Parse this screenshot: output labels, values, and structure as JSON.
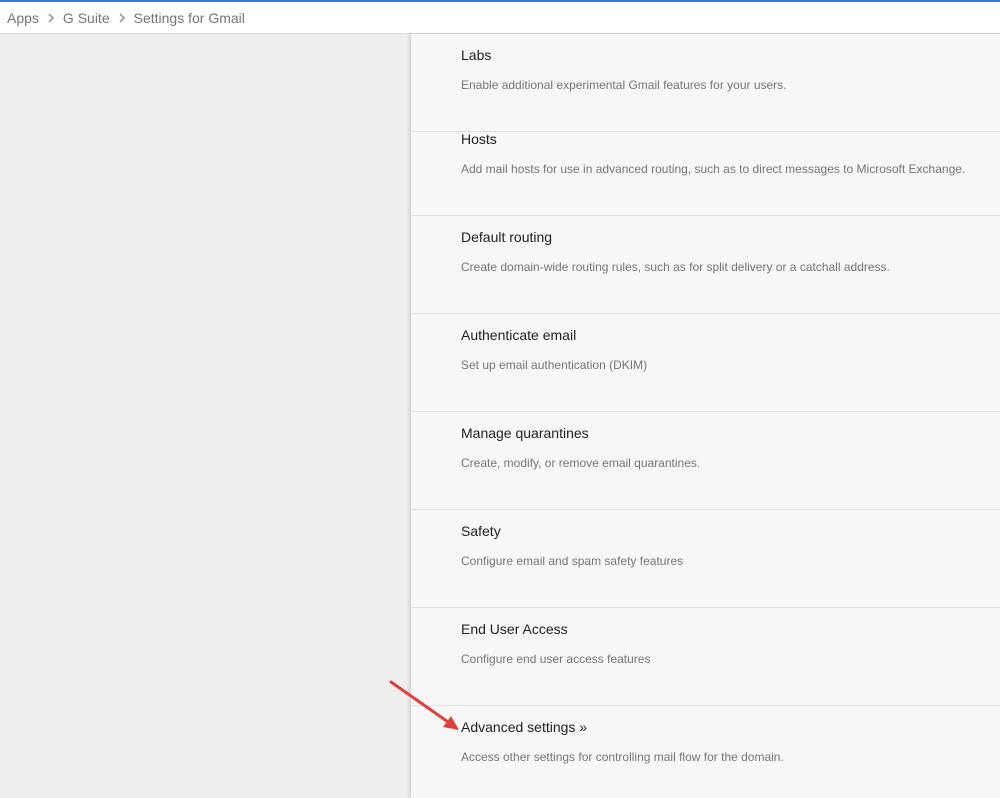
{
  "breadcrumb": {
    "items": [
      {
        "label": "Apps"
      },
      {
        "label": "G Suite"
      },
      {
        "label": "Settings for Gmail"
      }
    ]
  },
  "settings": [
    {
      "title": "Labs",
      "description": "Enable additional experimental Gmail features for your users."
    },
    {
      "title": "Hosts",
      "description": "Add mail hosts for use in advanced routing, such as to direct messages to Microsoft Exchange."
    },
    {
      "title": "Default routing",
      "description": "Create domain-wide routing rules, such as for split delivery or a catchall address."
    },
    {
      "title": "Authenticate email",
      "description": "Set up email authentication (DKIM)"
    },
    {
      "title": "Manage quarantines",
      "description": "Create, modify, or remove email quarantines."
    },
    {
      "title": "Safety",
      "description": "Configure email and spam safety features"
    },
    {
      "title": "End User Access",
      "description": "Configure end user access features"
    },
    {
      "title": "Advanced settings »",
      "description": "Access other settings for controlling mail flow for the domain."
    }
  ],
  "colors": {
    "accent_line": "#3b78e7",
    "annotation_arrow": "#d9433b"
  }
}
